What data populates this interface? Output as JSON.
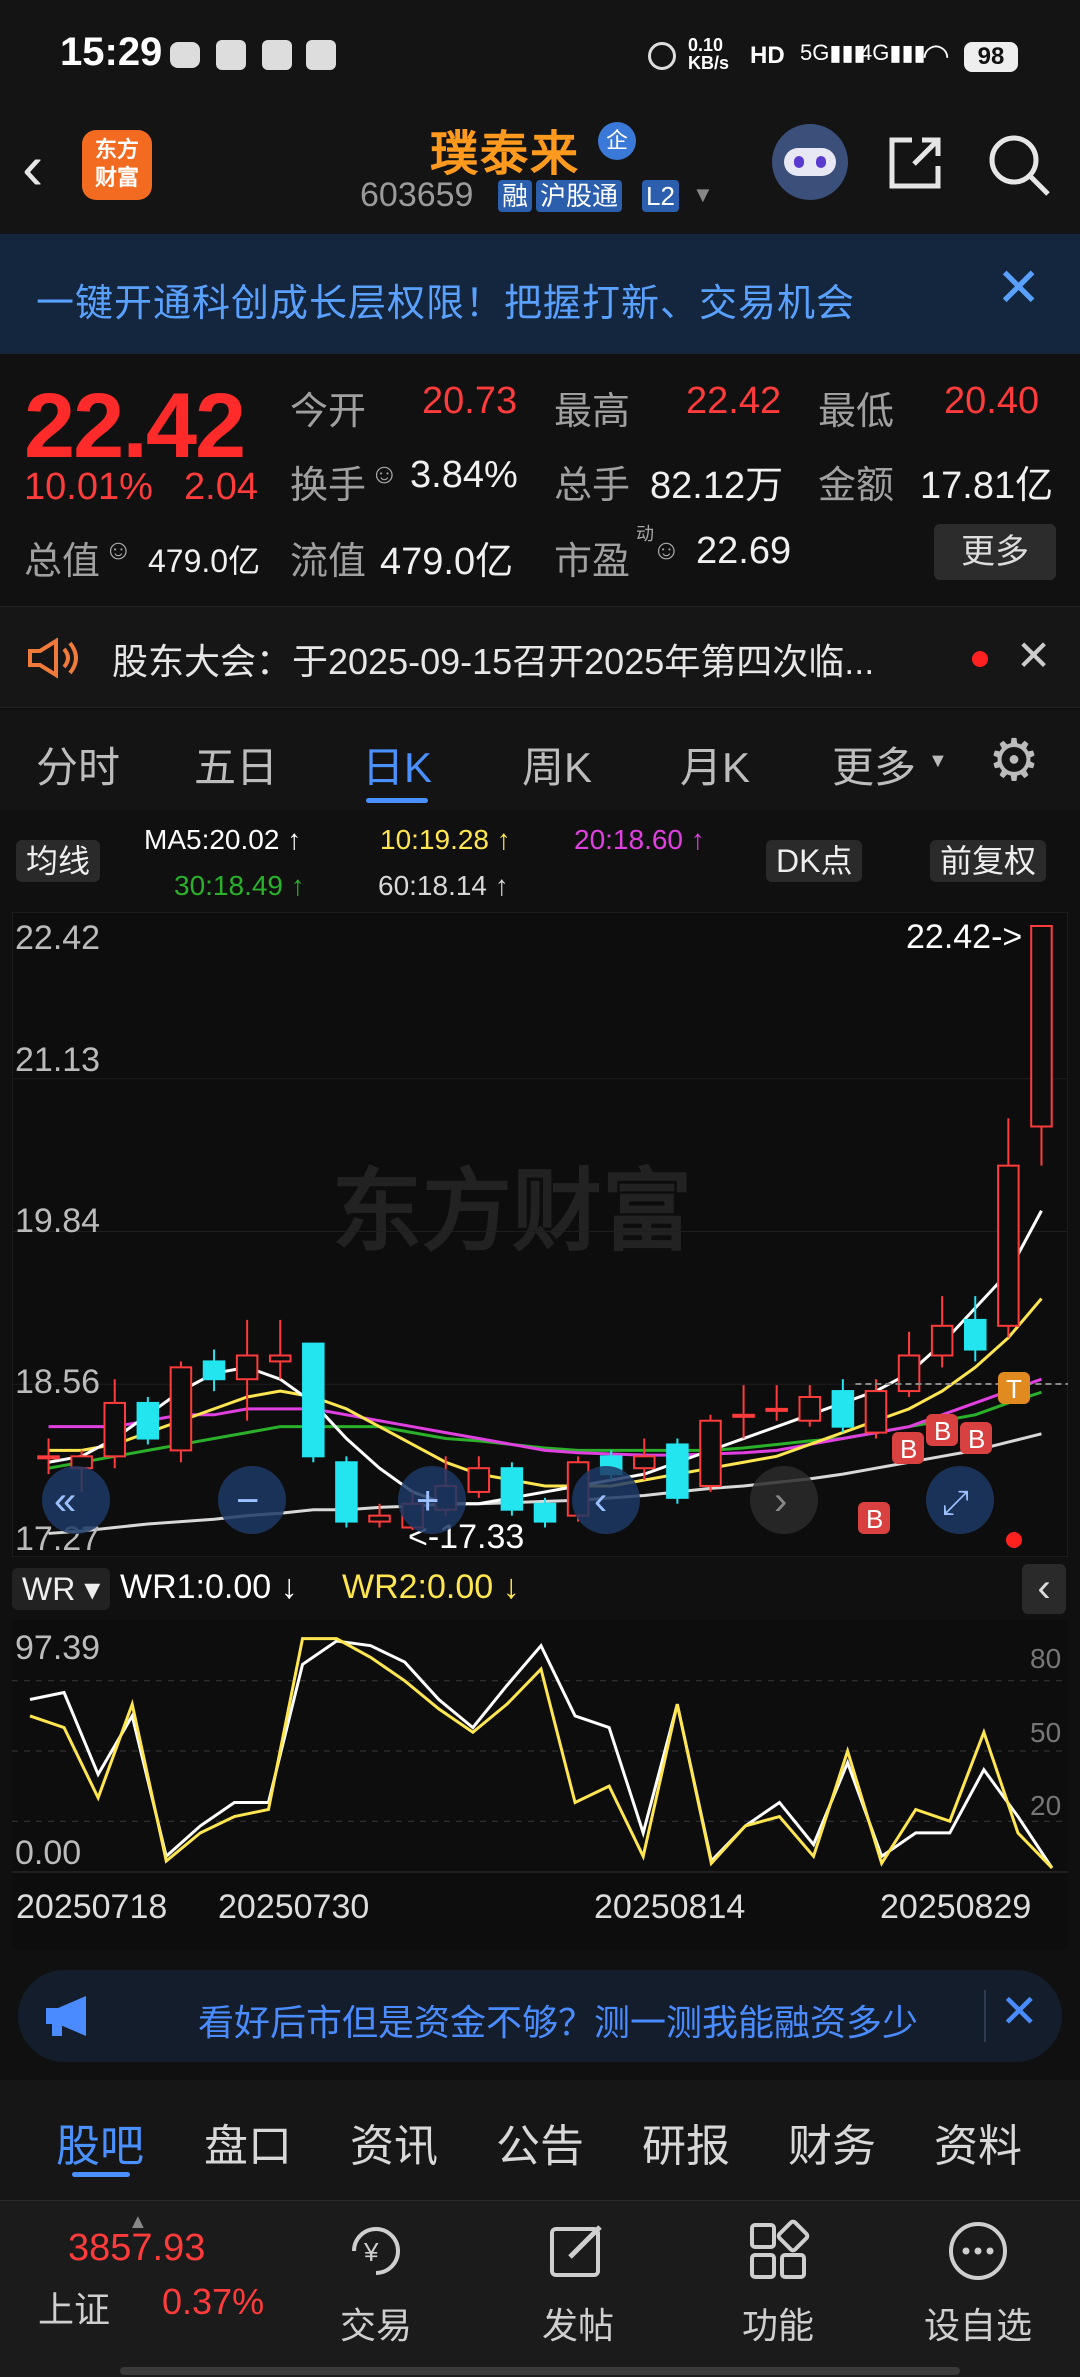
{
  "status_bar": {
    "time": "15:29",
    "net_speed": "0.10\nKB/s",
    "battery": "98"
  },
  "header": {
    "brand_logo": "东方\n财富",
    "stock_name": "璞泰来",
    "enterprise_badge": "企",
    "stock_code": "603659",
    "tags": [
      "融",
      "沪股通",
      "L2"
    ]
  },
  "banner": {
    "text": "一键开通科创成长层权限！把握打新、交易机会"
  },
  "quote": {
    "price": "22.42",
    "change_pct": "10.01%",
    "change": "2.04",
    "items": [
      {
        "label": "今开",
        "value": "20.73"
      },
      {
        "label": "最高",
        "value": "22.42"
      },
      {
        "label": "最低",
        "value": "20.40"
      },
      {
        "label": "换手",
        "value": "3.84%"
      },
      {
        "label": "总手",
        "value": "82.12万"
      },
      {
        "label": "金额",
        "value": "17.81亿"
      },
      {
        "label": "总值",
        "value": "479.0亿"
      },
      {
        "label": "流值",
        "value": "479.0亿"
      },
      {
        "label": "市盈",
        "value": "22.69"
      }
    ],
    "pe_superscript": "动",
    "more": "更多"
  },
  "notice": {
    "text": "股东大会：于2025-09-15召开2025年第四次临..."
  },
  "chart_tabs": [
    "分时",
    "五日",
    "日K",
    "周K",
    "月K",
    "更多"
  ],
  "active_tab": "日K",
  "ma_row": {
    "indicator_btn": "均线",
    "ma5": "MA5:20.02 ↑",
    "ma10": "10:19.28 ↑",
    "ma20": "20:18.60 ↑",
    "ma30": "30:18.49 ↑",
    "ma60": "60:18.14 ↑",
    "dk_btn": "DK点",
    "adjust_btn": "前复权"
  },
  "colors": {
    "up": "#ff3b3b",
    "down": "#22e5ef",
    "ma5": "#ffffff",
    "ma10": "#ffe650",
    "ma20": "#e040e0",
    "ma30": "#2ab02a",
    "ma60": "#d8d8d8"
  },
  "chart_data": [
    {
      "type": "candlestick",
      "ylim": [
        17.27,
        22.42
      ],
      "y_ticks": [
        "22.42",
        "21.13",
        "19.84",
        "18.56",
        "17.27"
      ],
      "watermark": "东方财富",
      "max_label": "22.42->",
      "min_label": "<-17.33",
      "signals": [
        "B",
        "B",
        "B",
        "B",
        "T"
      ],
      "candles": [
        {
          "o": 17.95,
          "c": 17.95,
          "h": 18.1,
          "l": 17.8
        },
        {
          "o": 17.85,
          "c": 17.95,
          "h": 18.0,
          "l": 17.65
        },
        {
          "o": 17.95,
          "c": 18.4,
          "h": 18.6,
          "l": 17.85
        },
        {
          "o": 18.4,
          "c": 18.1,
          "h": 18.45,
          "l": 18.05
        },
        {
          "o": 18.0,
          "c": 18.7,
          "h": 18.75,
          "l": 17.9
        },
        {
          "o": 18.75,
          "c": 18.6,
          "h": 18.85,
          "l": 18.5
        },
        {
          "o": 18.6,
          "c": 18.8,
          "h": 19.1,
          "l": 18.25
        },
        {
          "o": 18.75,
          "c": 18.8,
          "h": 19.1,
          "l": 18.6
        },
        {
          "o": 18.9,
          "c": 17.95,
          "h": 18.9,
          "l": 17.9
        },
        {
          "o": 17.9,
          "c": 17.4,
          "h": 17.95,
          "l": 17.35
        },
        {
          "o": 17.4,
          "c": 17.45,
          "h": 17.55,
          "l": 17.35
        },
        {
          "o": 17.35,
          "c": 17.55,
          "h": 17.65,
          "l": 17.33
        },
        {
          "o": 17.5,
          "c": 17.7,
          "h": 17.95,
          "l": 17.45
        },
        {
          "o": 17.65,
          "c": 17.85,
          "h": 17.95,
          "l": 17.6
        },
        {
          "o": 17.85,
          "c": 17.5,
          "h": 17.9,
          "l": 17.45
        },
        {
          "o": 17.55,
          "c": 17.4,
          "h": 17.6,
          "l": 17.35
        },
        {
          "o": 17.45,
          "c": 17.9,
          "h": 17.95,
          "l": 17.4
        },
        {
          "o": 17.95,
          "c": 17.8,
          "h": 18.0,
          "l": 17.75
        },
        {
          "o": 17.85,
          "c": 17.95,
          "h": 18.1,
          "l": 17.75
        },
        {
          "o": 18.05,
          "c": 17.6,
          "h": 18.1,
          "l": 17.55
        },
        {
          "o": 17.7,
          "c": 18.25,
          "h": 18.3,
          "l": 17.65
        },
        {
          "o": 18.3,
          "c": 18.3,
          "h": 18.55,
          "l": 18.1
        },
        {
          "o": 18.35,
          "c": 18.35,
          "h": 18.55,
          "l": 18.25
        },
        {
          "o": 18.25,
          "c": 18.45,
          "h": 18.55,
          "l": 18.2
        },
        {
          "o": 18.5,
          "c": 18.2,
          "h": 18.6,
          "l": 18.15
        },
        {
          "o": 18.15,
          "c": 18.5,
          "h": 18.6,
          "l": 18.1
        },
        {
          "o": 18.5,
          "c": 18.8,
          "h": 19.0,
          "l": 18.45
        },
        {
          "o": 18.8,
          "c": 19.05,
          "h": 19.3,
          "l": 18.7
        },
        {
          "o": 19.1,
          "c": 18.85,
          "h": 19.3,
          "l": 18.75
        },
        {
          "o": 19.05,
          "c": 20.4,
          "h": 20.8,
          "l": 18.95
        },
        {
          "o": 20.73,
          "c": 22.42,
          "h": 22.42,
          "l": 20.4
        }
      ],
      "ma5": [
        17.9,
        17.95,
        18.1,
        18.3,
        18.5,
        18.65,
        18.7,
        18.6,
        18.4,
        18.1,
        17.85,
        17.65,
        17.55,
        17.55,
        17.6,
        17.65,
        17.7,
        17.75,
        17.8,
        17.9,
        18.0,
        18.1,
        18.2,
        18.3,
        18.4,
        18.5,
        18.65,
        18.9,
        19.2,
        19.5,
        20.02
      ],
      "ma10": [
        18.0,
        18.0,
        18.05,
        18.15,
        18.25,
        18.35,
        18.45,
        18.5,
        18.45,
        18.35,
        18.2,
        18.05,
        17.9,
        17.8,
        17.75,
        17.7,
        17.7,
        17.7,
        17.75,
        17.8,
        17.85,
        17.9,
        17.95,
        18.05,
        18.15,
        18.25,
        18.35,
        18.5,
        18.7,
        18.95,
        19.28
      ],
      "ma20": [
        18.2,
        18.2,
        18.2,
        18.25,
        18.3,
        18.3,
        18.35,
        18.35,
        18.35,
        18.3,
        18.25,
        18.2,
        18.15,
        18.1,
        18.05,
        18.0,
        17.98,
        17.97,
        17.96,
        17.96,
        17.97,
        17.98,
        18.0,
        18.05,
        18.1,
        18.15,
        18.2,
        18.3,
        18.4,
        18.5,
        18.6
      ],
      "ma30": [
        17.85,
        17.9,
        17.95,
        18.0,
        18.05,
        18.1,
        18.15,
        18.2,
        18.2,
        18.2,
        18.2,
        18.15,
        18.1,
        18.08,
        18.05,
        18.02,
        18.0,
        18.0,
        18.0,
        18.0,
        18.0,
        18.02,
        18.05,
        18.08,
        18.1,
        18.15,
        18.2,
        18.25,
        18.3,
        18.4,
        18.49
      ],
      "ma60": [
        17.3,
        17.32,
        17.35,
        17.38,
        17.4,
        17.42,
        17.45,
        17.47,
        17.5,
        17.5,
        17.52,
        17.53,
        17.55,
        17.55,
        17.56,
        17.57,
        17.58,
        17.6,
        17.62,
        17.65,
        17.68,
        17.7,
        17.73,
        17.76,
        17.8,
        17.85,
        17.9,
        17.95,
        18.0,
        18.07,
        18.14
      ]
    },
    {
      "type": "line",
      "title": "WR",
      "series": [
        {
          "name": "WR1:0.00 ↓",
          "values": [
            72,
            75,
            40,
            65,
            5,
            18,
            28,
            28,
            87,
            97,
            95,
            88,
            72,
            60,
            78,
            95,
            65,
            60,
            15,
            70,
            3,
            18,
            28,
            10,
            45,
            5,
            15,
            15,
            42,
            22,
            0
          ]
        },
        {
          "name": "WR2:0.00 ↓",
          "values": [
            65,
            60,
            30,
            70,
            3,
            15,
            22,
            25,
            98,
            98,
            90,
            80,
            68,
            58,
            70,
            85,
            28,
            35,
            5,
            70,
            2,
            18,
            22,
            5,
            50,
            2,
            25,
            20,
            58,
            15,
            0
          ]
        }
      ],
      "ylim": [
        0,
        100
      ],
      "y_ticks": [
        "97.39",
        "0.00"
      ],
      "right_ticks": [
        "80",
        "50",
        "20"
      ],
      "x_ticks": [
        "20250718",
        "20250730",
        "20250814",
        "20250829"
      ]
    }
  ],
  "ad_bar": {
    "text": "看好后市但是资金不够？测一测我能融资多少"
  },
  "bottom_tabs": [
    "股吧",
    "盘口",
    "资讯",
    "公告",
    "研报",
    "财务",
    "资料"
  ],
  "active_bottom_tab": "股吧",
  "toolbar": {
    "index_value": "3857.93",
    "index_name": "上证",
    "index_pct": "0.37%",
    "trade": "交易",
    "post": "发帖",
    "functions": "功能",
    "watchlist": "设自选"
  }
}
